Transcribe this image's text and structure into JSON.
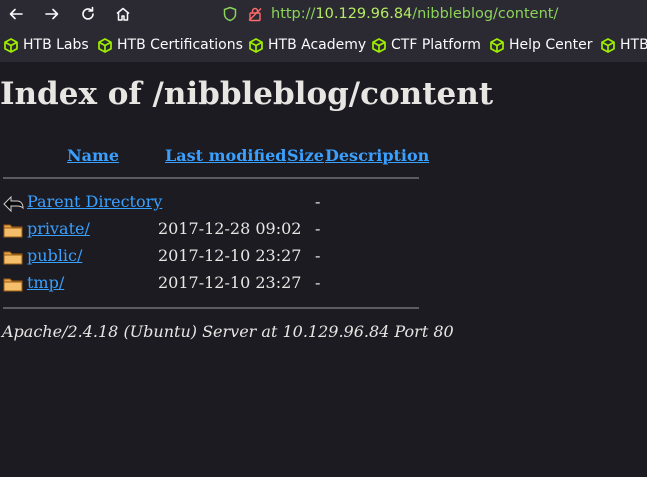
{
  "browser": {
    "url_scheme": "http://",
    "url_host": "10.129.96.84",
    "url_path": "/nibbleblog/content/"
  },
  "bookmarks": [
    {
      "label": "HTB Labs"
    },
    {
      "label": "HTB Certifications"
    },
    {
      "label": "HTB Academy"
    },
    {
      "label": "CTF Platform"
    },
    {
      "label": "Help Center"
    },
    {
      "label": "HTB"
    }
  ],
  "page": {
    "title": "Index of /nibbleblog/content",
    "columns": {
      "name": "Name",
      "last_modified": "Last modified",
      "size": "Size",
      "description": "Description"
    },
    "rows": [
      {
        "name": "Parent Directory",
        "date": "",
        "size": "-",
        "icon": "back-icon"
      },
      {
        "name": "private/",
        "date": "2017-12-28 09:02",
        "size": "-",
        "icon": "folder-icon"
      },
      {
        "name": "public/",
        "date": "2017-12-10 23:27",
        "size": "-",
        "icon": "folder-icon"
      },
      {
        "name": "tmp/",
        "date": "2017-12-10 23:27",
        "size": "-",
        "icon": "folder-icon"
      }
    ],
    "footer": "Apache/2.4.18 (Ubuntu) Server at 10.129.96.84 Port 80"
  },
  "colors": {
    "link": "#3aa0ff",
    "bookmark_icon": "#9fef00",
    "background": "#1c1b22"
  }
}
